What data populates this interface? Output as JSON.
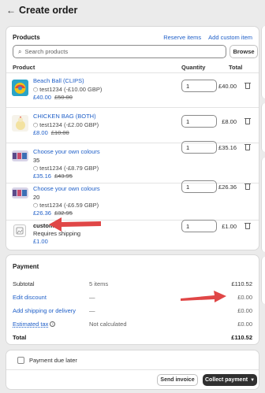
{
  "header": {
    "title": "Create order",
    "back_icon": "arrow-left-icon"
  },
  "products": {
    "heading": "Products",
    "reserve_label": "Reserve items",
    "add_custom_label": "Add custom item",
    "search_placeholder": "Search products",
    "browse_label": "Browse",
    "columns": {
      "product": "Product",
      "quantity": "Quantity",
      "total": "Total"
    },
    "items": [
      {
        "name": "Beach Ball (CLIPS)",
        "variant": "",
        "discount": "test1234 (-£10.00 GBP)",
        "price": "£40.00",
        "was": "£50.00",
        "qty": "1",
        "total": "£40.00"
      },
      {
        "name": "CHICKEN BAG (BOTH)",
        "variant": "",
        "discount": "test1234 (-£2.00 GBP)",
        "price": "£8.00",
        "was": "£10.00",
        "qty": "1",
        "total": "£8.00"
      },
      {
        "name": "Choose your own colours",
        "variant": "35",
        "discount": "test1234 (-£8.79 GBP)",
        "price": "£35.16",
        "was": "£43.95",
        "qty": "1",
        "total": "£35.16"
      },
      {
        "name": "Choose your own colours",
        "variant": "20",
        "discount": "test1234 (-£6.59 GBP)",
        "price": "£26.36",
        "was": "£32.95",
        "qty": "1",
        "total": "£26.36"
      },
      {
        "name": "custom",
        "variant": "Requires shipping",
        "discount": "",
        "price": "£1.00",
        "was": "",
        "qty": "1",
        "total": "£1.00"
      }
    ]
  },
  "payment": {
    "heading": "Payment",
    "subtotal_label": "Subtotal",
    "subtotal_items": "5 items",
    "subtotal_value": "£110.52",
    "discount_label": "Edit discount",
    "discount_mid": "—",
    "discount_value": "£0.00",
    "shipping_label": "Add shipping or delivery",
    "shipping_mid": "—",
    "shipping_value": "£0.00",
    "tax_label": "Estimated tax",
    "tax_mid": "Not calculated",
    "tax_value": "£0.00",
    "total_label": "Total",
    "total_value": "£110.52"
  },
  "footer": {
    "payment_due_later_label": "Payment due later",
    "send_invoice_label": "Send invoice",
    "collect_payment_label": "Collect payment"
  },
  "colors": {
    "link": "#1f5fc8",
    "annotation_arrow": "#e04646",
    "primary_button": "#303030"
  }
}
